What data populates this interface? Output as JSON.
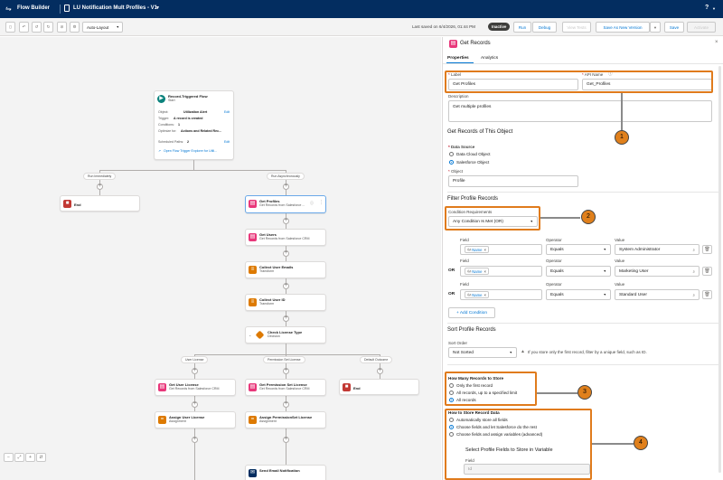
{
  "topbar": {
    "app_name": "Flow Builder",
    "flow_title": "LU Notification Mult Profiles - V1",
    "help": "?"
  },
  "toolbar": {
    "layout": "Auto-Layout",
    "saved_text": "Last saved on 6/4/2026, 01:44 PM",
    "status": "Inactive",
    "run": "Run",
    "debug": "Debug",
    "view_tests": "View Tests",
    "save_as_new": "Save As New Version",
    "save": "Save",
    "activate": "Activate"
  },
  "canvas": {
    "start": {
      "title": "Record-Triggered Flow",
      "subtitle": "Start",
      "object_label": "Object:",
      "object_value": "Utilization Alert",
      "trigger_label": "Trigger:",
      "trigger_value": "A record is created",
      "conditions_label": "Conditions:",
      "conditions_value": "1",
      "optimize_label": "Optimize for:",
      "optimize_value": "Actions and Related Rec...",
      "paths_label": "Scheduled Paths:",
      "paths_value": "2",
      "edit": "Edit",
      "explorer_link": "Open Flow Trigger Explorer for Utili..."
    },
    "path_immediate": "Run Immediately",
    "path_async": "Run Asynchronously",
    "end": "End",
    "nodes": [
      {
        "title": "Get Profiles",
        "sub": "Get Records from Salesforce ..."
      },
      {
        "title": "Get Users",
        "sub": "Get Records from Salesforce CRM"
      },
      {
        "title": "Collect User Emails",
        "sub": "Transform"
      },
      {
        "title": "Collect User ID",
        "sub": "Transform"
      },
      {
        "title": "Check License Type",
        "sub": "Decision"
      }
    ],
    "branches": [
      "User License",
      "Permission Set License",
      "Default Outcome"
    ],
    "branch_nodes": [
      {
        "title": "Get User License",
        "sub": "Get Records from Salesforce CRM"
      },
      {
        "title": "Get Permission Set License",
        "sub": "Get Records from Salesforce CRM"
      },
      {
        "title": "Assign User License",
        "sub": "Assignment"
      },
      {
        "title": "Assign PermissionSet License",
        "sub": "Assignment"
      }
    ],
    "send_email": "Send Email Notification"
  },
  "panel": {
    "title": "Get Records",
    "tabs": [
      "Properties",
      "Analytics"
    ],
    "label_label": "Label",
    "label_value": "Get Profiles",
    "api_label": "API Name",
    "api_value": "Get_Profiles",
    "desc_label": "Description",
    "desc_value": "Get multiple profiles",
    "section_object": "Get Records of This Object",
    "data_source_label": "Data Source",
    "ds_opt1": "Data Cloud Object",
    "ds_opt2": "Salesforce Object",
    "object_label": "Object",
    "object_value": "Profile",
    "section_filter": "Filter Profile Records",
    "cond_label": "Condition Requirements",
    "cond_value": "Any Condition Is Met (OR)",
    "col_field": "Field",
    "col_operator": "Operator",
    "col_value": "Value",
    "or": "OR",
    "rows": [
      {
        "field": "Name",
        "op": "Equals",
        "value": "System Administrator"
      },
      {
        "field": "Name",
        "op": "Equals",
        "value": "Marketing User"
      },
      {
        "field": "Name",
        "op": "Equals",
        "value": "Standard User"
      }
    ],
    "add_condition": "+ Add Condition",
    "section_sort": "Sort Profile Records",
    "sort_label": "Sort Order",
    "sort_value": "Not Sorted",
    "sort_hint": "If you store only the first record, filter by a unique field, such as ID.",
    "how_many_title": "How Many Records to Store",
    "hm1": "Only the first record",
    "hm2": "All records, up to a specified limit",
    "hm3": "All records",
    "how_store_title": "How to Store Record Data",
    "hs1": "Automatically store all fields",
    "hs2": "Choose fields and let Salesforce do the rest",
    "hs3": "Choose fields and assign variables (advanced)",
    "select_fields": "Select Profile Fields to Store in Variable",
    "field_label": "Field",
    "field_value": "Id"
  },
  "badges": [
    "1",
    "2",
    "3",
    "4"
  ],
  "colors": {
    "header": "#032d60",
    "highlight": "#e07b1c",
    "brand": "#0176d3",
    "get_records_icon": "#e8377a",
    "transform_icon": "#dd7a01",
    "decision_icon": "#dd7a01",
    "end_icon": "#c23934",
    "start_icon": "#0b827c"
  }
}
